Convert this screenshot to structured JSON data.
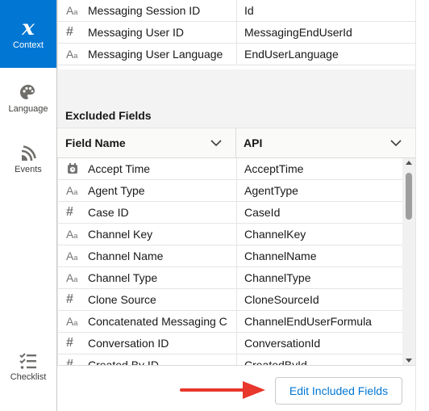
{
  "rail": {
    "context_label": "Context",
    "context_glyph": "x",
    "language_label": "Language",
    "events_label": "Events",
    "checklist_label": "Checklist"
  },
  "included_rows": [
    {
      "icon": "text-icon",
      "name": "Messaging Session ID",
      "api": "Id"
    },
    {
      "icon": "number-icon",
      "name": "Messaging User ID",
      "api": "MessagingEndUserId"
    },
    {
      "icon": "text-icon",
      "name": "Messaging User Language",
      "api": "EndUserLanguage"
    }
  ],
  "excluded": {
    "title": "Excluded Fields",
    "col_name": "Field Name",
    "col_api": "API",
    "rows": [
      {
        "icon": "clock-icon",
        "name": "Accept Time",
        "api": "AcceptTime"
      },
      {
        "icon": "text-icon",
        "name": "Agent Type",
        "api": "AgentType"
      },
      {
        "icon": "number-icon",
        "name": "Case ID",
        "api": "CaseId"
      },
      {
        "icon": "text-icon",
        "name": "Channel Key",
        "api": "ChannelKey"
      },
      {
        "icon": "text-icon",
        "name": "Channel Name",
        "api": "ChannelName"
      },
      {
        "icon": "text-icon",
        "name": "Channel Type",
        "api": "ChannelType"
      },
      {
        "icon": "number-icon",
        "name": "Clone Source",
        "api": "CloneSourceId"
      },
      {
        "icon": "text-icon",
        "name": "Concatenated Messaging Ch",
        "api": "ChannelEndUserFormula"
      },
      {
        "icon": "number-icon",
        "name": "Conversation ID",
        "api": "ConversationId"
      },
      {
        "icon": "number-icon",
        "name": "Created By ID",
        "api": "CreatedById"
      }
    ]
  },
  "footer": {
    "edit_button": "Edit Included Fields"
  },
  "colors": {
    "brand": "#0176d3",
    "arrow": "#e8372c"
  }
}
